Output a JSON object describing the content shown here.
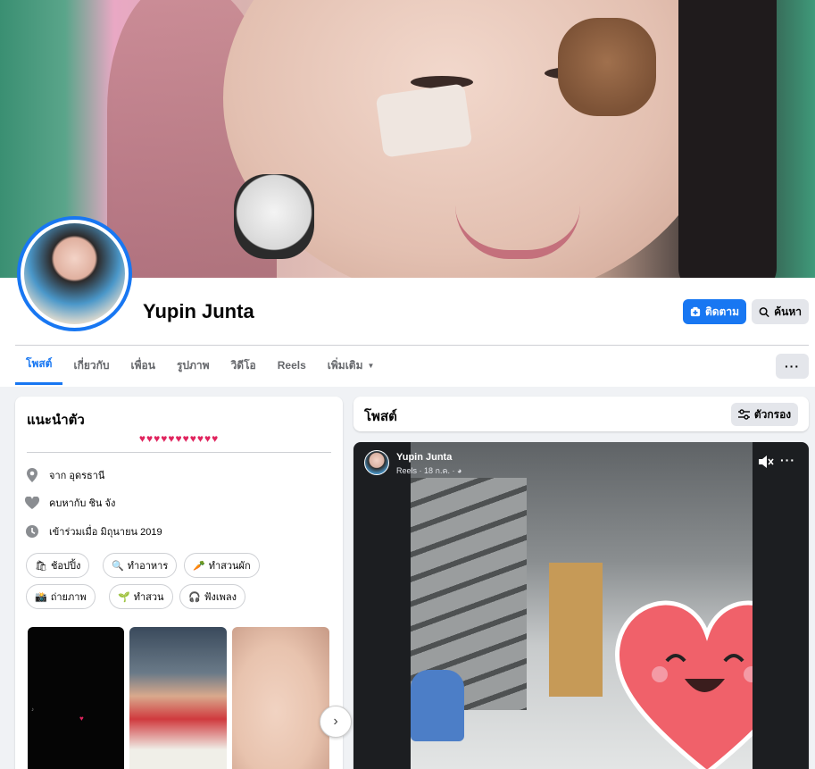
{
  "profile": {
    "name": "Yupin Junta",
    "follow_label": "ติดตาม",
    "search_label": "ค้นหา",
    "more_label": "···"
  },
  "tabs": [
    "โพสต์",
    "เกี่ยวกับ",
    "เพื่อน",
    "รูปภาพ",
    "วิดีโอ",
    "Reels",
    "เพิ่มเติม"
  ],
  "intro": {
    "title": "แนะนำตัว",
    "bio": "♥♥♥♥♥♥♥♥♥♥♥",
    "from": "จาก อุดรธานี",
    "relationship": "คบหากับ ชิน จัง",
    "joined": "เข้าร่วมเมื่อ มิถุนายน 2019",
    "hobbies": [
      {
        "icon": "🛍",
        "label": "ช้อปปิ้ง"
      },
      {
        "icon": "🔍",
        "label": "ทำอาหาร"
      },
      {
        "icon": "🥕",
        "label": "ทำสวนผัก"
      },
      {
        "icon": "📸",
        "label": "ถ่ายภาพ"
      },
      {
        "icon": "🌱",
        "label": "ทำสวน"
      },
      {
        "icon": "🎧",
        "label": "ฟังเพลง"
      }
    ]
  },
  "posts": {
    "title": "โพสต์",
    "filter_label": "ตัวกรอง"
  },
  "reel": {
    "author": "Yupin Junta",
    "meta": "Reels · 18 ก.ค. · ◕"
  },
  "colors": {
    "accent": "#1877f2",
    "background": "#f0f2f5",
    "button_gray": "#e4e6eb"
  }
}
